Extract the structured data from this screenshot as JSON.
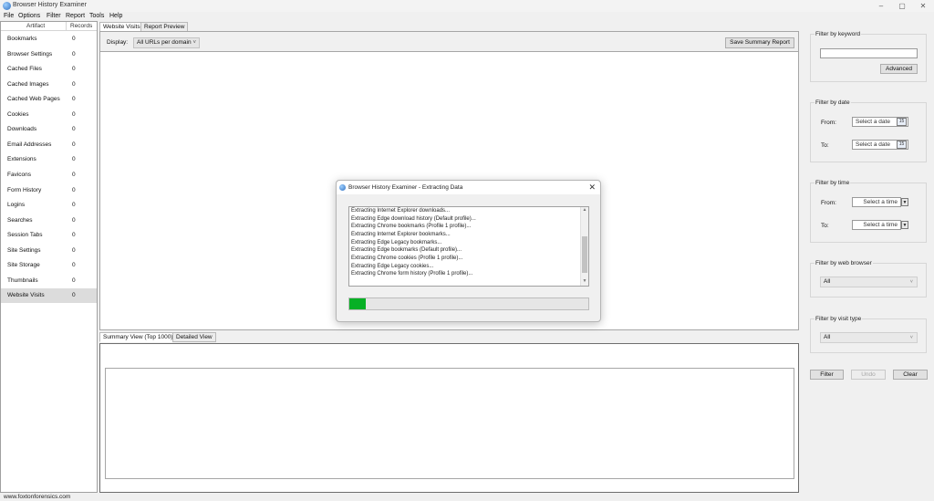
{
  "window": {
    "title": "Browser History Examiner",
    "minimize": "–",
    "maximize": "▢",
    "close": "✕"
  },
  "menu": [
    "File",
    "Options",
    "Filter",
    "Report",
    "Tools",
    "Help"
  ],
  "sidebar": {
    "header_artifact": "Artifact",
    "header_records": "Records",
    "items": [
      {
        "name": "Bookmarks",
        "count": "0"
      },
      {
        "name": "Browser Settings",
        "count": "0"
      },
      {
        "name": "Cached Files",
        "count": "0"
      },
      {
        "name": "Cached Images",
        "count": "0"
      },
      {
        "name": "Cached Web Pages",
        "count": "0"
      },
      {
        "name": "Cookies",
        "count": "0"
      },
      {
        "name": "Downloads",
        "count": "0"
      },
      {
        "name": "Email Addresses",
        "count": "0"
      },
      {
        "name": "Extensions",
        "count": "0"
      },
      {
        "name": "Favicons",
        "count": "0"
      },
      {
        "name": "Form History",
        "count": "0"
      },
      {
        "name": "Logins",
        "count": "0"
      },
      {
        "name": "Searches",
        "count": "0"
      },
      {
        "name": "Session Tabs",
        "count": "0"
      },
      {
        "name": "Site Settings",
        "count": "0"
      },
      {
        "name": "Site Storage",
        "count": "0"
      },
      {
        "name": "Thumbnails",
        "count": "0"
      },
      {
        "name": "Website Visits",
        "count": "0",
        "selected": true
      }
    ]
  },
  "tabs": {
    "website_visits": "Website Visits",
    "report_preview": "Report Preview"
  },
  "display": {
    "label": "Display:",
    "value": "All URLs per domain",
    "save_report": "Save Summary Report"
  },
  "lower_tabs": {
    "summary": "Summary View (Top 1000)",
    "detailed": "Detailed View"
  },
  "filters": {
    "keyword": {
      "title": "Filter by keyword",
      "value": "",
      "advanced": "Advanced"
    },
    "date": {
      "title": "Filter by date",
      "from_label": "From:",
      "to_label": "To:",
      "from_value": "Select a date",
      "to_value": "Select a date",
      "cal_icon": "15"
    },
    "time": {
      "title": "Filter by time",
      "from_label": "From:",
      "to_label": "To:",
      "from_value": "Select a time",
      "to_value": "Select a time"
    },
    "browser": {
      "title": "Filter by web browser",
      "value": "All"
    },
    "visit_type": {
      "title": "Filter by visit type",
      "value": "All"
    },
    "buttons": {
      "filter": "Filter",
      "undo": "Undo",
      "clear": "Clear"
    }
  },
  "status": {
    "text": "www.foxtonforensics.com"
  },
  "dialog": {
    "title": "Browser History Examiner - Extracting Data",
    "log": [
      "Extracting Internet Explorer downloads...",
      "Extracting Edge download history (Default profile)...",
      "Extracting Chrome bookmarks (Profile 1 profile)...",
      "Extracting Internet Explorer bookmarks...",
      "Extracting Edge Legacy bookmarks...",
      "Extracting Edge bookmarks (Default profile)...",
      "Extracting Chrome cookies (Profile 1 profile)...",
      "Extracting Edge Legacy cookies...",
      "Extracting Chrome form history (Profile 1 profile)..."
    ],
    "progress_percent": 7
  },
  "colors": {
    "progress": "#06b025",
    "selected_row": "#dcdcdc"
  }
}
